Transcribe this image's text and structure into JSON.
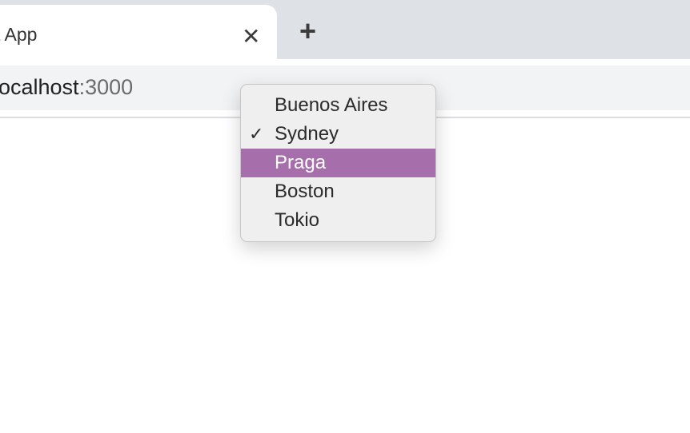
{
  "browser": {
    "tab": {
      "title": "t App",
      "close_icon": "close-icon"
    },
    "new_tab_icon": "plus-icon",
    "address": {
      "host": "localhost",
      "port": ":3000"
    }
  },
  "dropdown": {
    "options": [
      {
        "label": "Buenos Aires"
      },
      {
        "label": "Sydney",
        "check": "✓"
      },
      {
        "label": "Praga"
      },
      {
        "label": "Boston"
      },
      {
        "label": "Tokio"
      }
    ],
    "selected": "Sydney",
    "highlighted": "Praga",
    "highlight_color": "#a66fab"
  }
}
